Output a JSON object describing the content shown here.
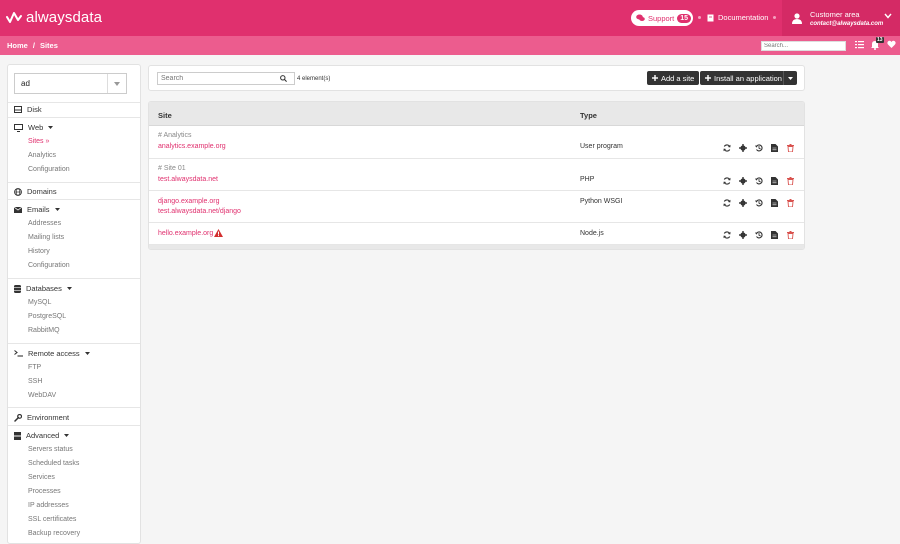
{
  "header": {
    "logo": "alwaysdata",
    "support_label": "Support",
    "support_count": "15",
    "docs_label": "Documentation",
    "customer_title": "Customer area",
    "customer_email": "contact@alwaysdata.com"
  },
  "breadcrumb": {
    "home": "Home",
    "sep": "/",
    "current": "Sites"
  },
  "topsearch": {
    "placeholder": "Search..."
  },
  "notifications": {
    "count": "13"
  },
  "account_select": {
    "value": "ad"
  },
  "sidebar": {
    "disk": "Disk",
    "web": "Web",
    "web_items": [
      "Sites »",
      "Analytics",
      "Configuration"
    ],
    "domains": "Domains",
    "emails": "Emails",
    "email_items": [
      "Addresses",
      "Mailing lists",
      "History",
      "Configuration"
    ],
    "databases": "Databases",
    "db_items": [
      "MySQL",
      "PostgreSQL",
      "RabbitMQ"
    ],
    "remote": "Remote access",
    "remote_items": [
      "FTP",
      "SSH",
      "WebDAV"
    ],
    "environment": "Environment",
    "advanced": "Advanced",
    "advanced_items": [
      "Servers status",
      "Scheduled tasks",
      "Services",
      "Processes",
      "IP addresses",
      "SSL certificates",
      "Backup recovery"
    ]
  },
  "toolbar": {
    "search_placeholder": "Search",
    "count": "4 element(s)",
    "add_site": "Add a site",
    "install_app": "Install an application"
  },
  "table": {
    "columns": [
      "Site",
      "Type"
    ],
    "rows": [
      {
        "name": "# Analytics",
        "addr1": "analytics.example.org",
        "addr2": "",
        "type": "User program",
        "warning": false
      },
      {
        "name": "# Site 01",
        "addr1": "test.alwaysdata.net",
        "addr2": "",
        "type": "PHP",
        "warning": false
      },
      {
        "name": "",
        "addr1": "django.example.org",
        "addr2": "test.alwaysdata.net/django",
        "type": "Python WSGI",
        "warning": false
      },
      {
        "name": "",
        "addr1": "hello.example.org",
        "addr2": "",
        "type": "Node.js",
        "warning": true
      }
    ]
  },
  "colors": {
    "brand": "#e0306e",
    "brand_light": "#ec5c8e",
    "danger": "#d9534f",
    "warning": "#d32f2f"
  }
}
